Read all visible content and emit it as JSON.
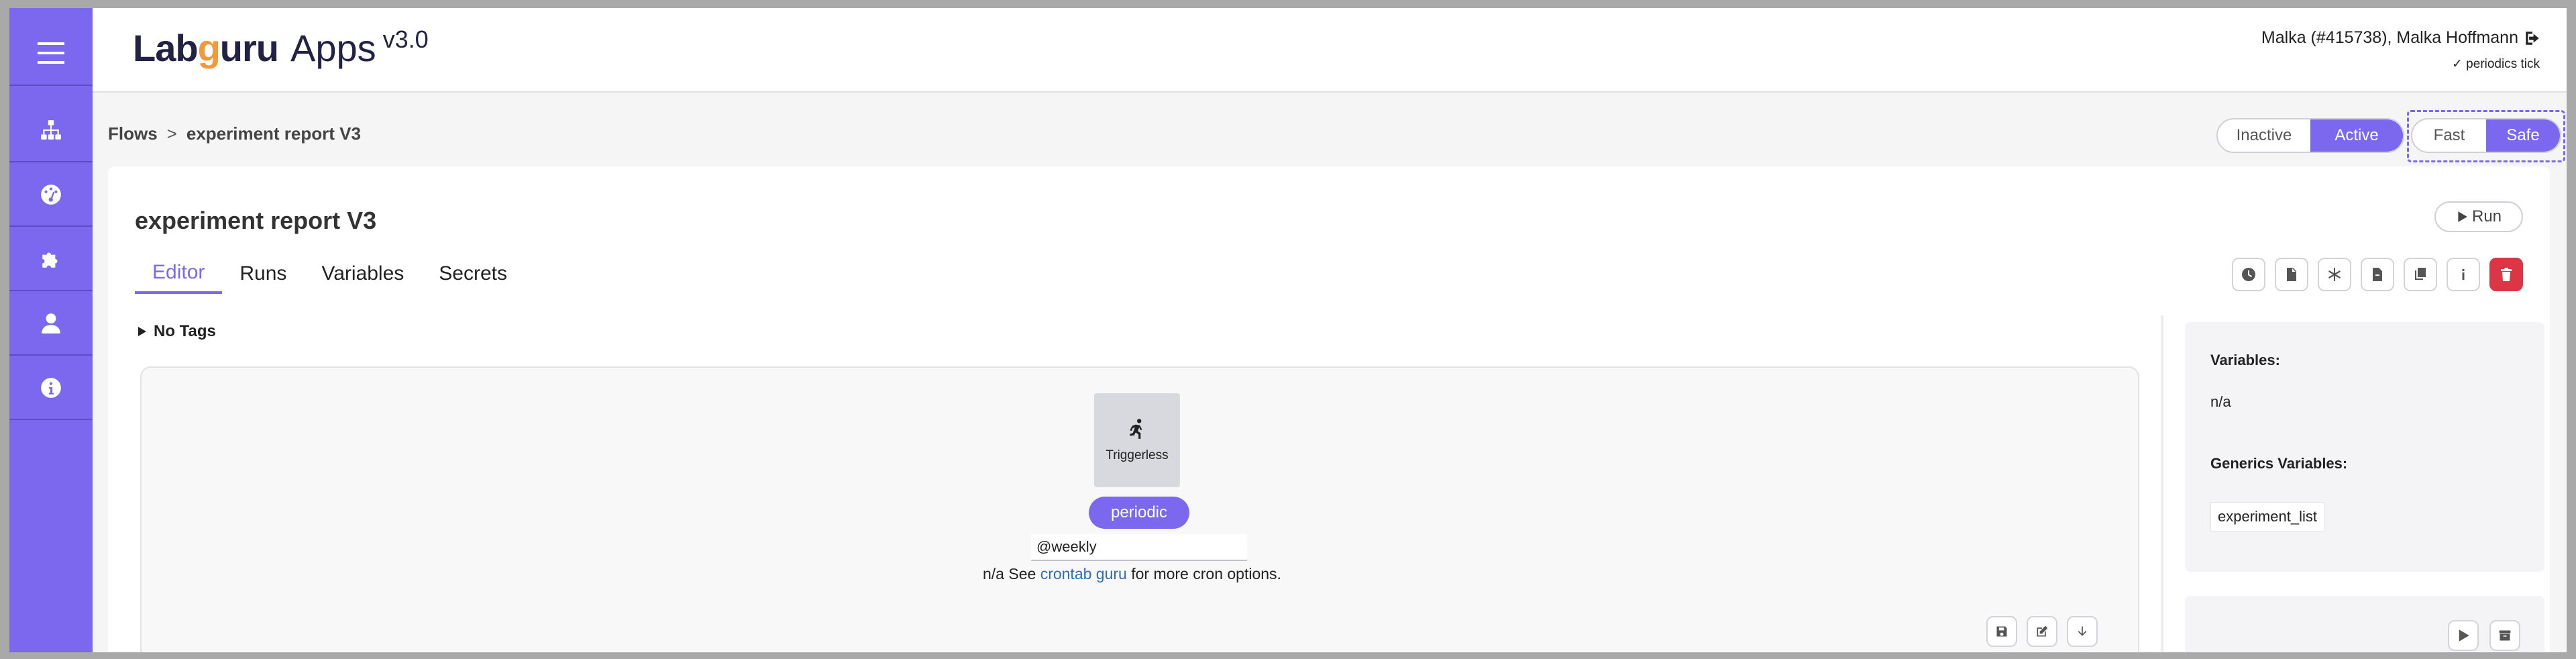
{
  "app": {
    "logo_lab": "Lab",
    "logo_o": "g",
    "logo_rest": "uru",
    "logo_apps": "Apps",
    "version": "v3.0"
  },
  "user": {
    "name": "Malka (#415738), Malka Hoffmann",
    "status": "✓ periodics tick"
  },
  "sidebar": {
    "items": [
      {
        "icon": "hamburger-menu-icon"
      },
      {
        "icon": "sitemap-icon"
      },
      {
        "icon": "gauge-icon"
      },
      {
        "icon": "puzzle-icon"
      },
      {
        "icon": "user-icon"
      },
      {
        "icon": "info-icon"
      }
    ]
  },
  "breadcrumb": {
    "root": "Flows",
    "separator": ">",
    "current": "experiment report V3"
  },
  "status_toggle": {
    "inactive": "Inactive",
    "active": "Active",
    "selected": "Active"
  },
  "mode_toggle": {
    "fast": "Fast",
    "safe": "Safe",
    "selected": "Safe"
  },
  "flow": {
    "title": "experiment report V3",
    "run_label": "Run"
  },
  "tabs": [
    {
      "label": "Editor",
      "active": true
    },
    {
      "label": "Runs",
      "active": false
    },
    {
      "label": "Variables",
      "active": false
    },
    {
      "label": "Secrets",
      "active": false
    }
  ],
  "toolbar": [
    {
      "icon": "clock-icon"
    },
    {
      "icon": "file-icon"
    },
    {
      "icon": "asterisk-icon"
    },
    {
      "icon": "file-export-icon"
    },
    {
      "icon": "copy-icon"
    },
    {
      "icon": "info-icon"
    },
    {
      "icon": "trash-icon"
    }
  ],
  "tags": {
    "label": "No Tags"
  },
  "canvas": {
    "trigger_label": "Triggerless",
    "trigger_type": "periodic",
    "cron_value": "@weekly",
    "cron_help_prefix": "n/a See ",
    "cron_help_link": "crontab guru",
    "cron_help_suffix": " for more cron options."
  },
  "variables_panel": {
    "variables_label": "Variables:",
    "variables_value": "n/a",
    "generics_label": "Generics Variables:",
    "generics_value": "experiment_list"
  },
  "colors": {
    "accent": "#7b68ee",
    "danger": "#dc3546",
    "link": "#2f6db5"
  }
}
